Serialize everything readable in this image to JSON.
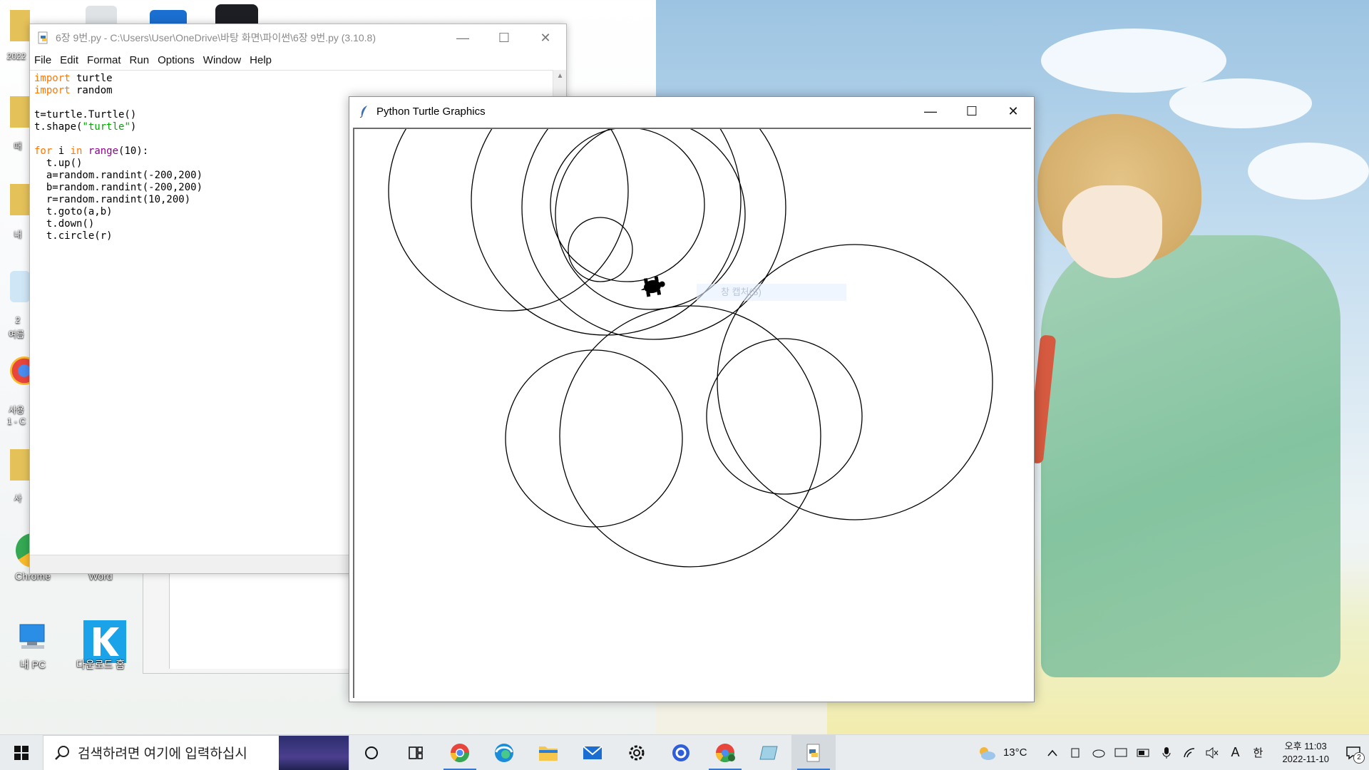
{
  "desktop": {
    "icons": [
      {
        "label": "Chrome"
      },
      {
        "label": "Word"
      },
      {
        "label": "내 PC"
      },
      {
        "label": "다운로드 홈"
      }
    ],
    "partial_labels": [
      "2022",
      "때",
      "내",
      "2",
      "여름",
      "사용",
      "1 - C",
      "사"
    ]
  },
  "idle": {
    "title": "6장 9번.py - C:\\Users\\User\\OneDrive\\바탕 화면\\파이썬\\6장 9번.py (3.10.8)",
    "menu": [
      "File",
      "Edit",
      "Format",
      "Run",
      "Options",
      "Window",
      "Help"
    ],
    "code": {
      "l1_kw": "import",
      "l1_rest": " turtle",
      "l2_kw": "import",
      "l2_rest": " random",
      "l4": "t=turtle.Turtle()",
      "l5_a": "t.shape(",
      "l5_str": "\"turtle\"",
      "l5_b": ")",
      "l7_for": "for",
      "l7_i": " i ",
      "l7_in": "in",
      "l7_sp": " ",
      "l7_range": "range",
      "l7_rest": "(10):",
      "l8": "  t.up()",
      "l9": "  a=random.randint(-200,200)",
      "l10": "  b=random.randint(-200,200)",
      "l11": "  r=random.randint(10,200)",
      "l12": "  t.goto(a,b)",
      "l13": "  t.down()",
      "l14": "  t.circle(r)"
    }
  },
  "turtle_window": {
    "title": "Python Turtle Graphics",
    "ghost_tooltip": "창 캡처(S)"
  },
  "controls": {
    "minimize": "—",
    "maximize": "☐",
    "close": "✕"
  },
  "taskbar": {
    "search_placeholder": "검색하려면 여기에 입력하십시",
    "weather": "13°C",
    "ime_mode": "A",
    "ime_lang": "한",
    "time_period": "오후 11:03",
    "date": "2022-11-10",
    "notification_count": "2"
  }
}
